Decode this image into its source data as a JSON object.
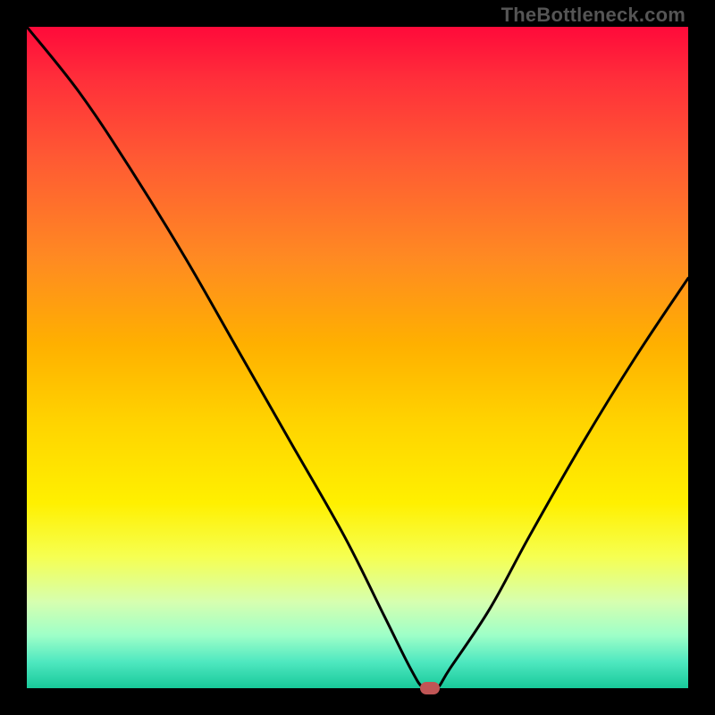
{
  "watermark": "TheBottleneck.com",
  "chart_data": {
    "type": "line",
    "title": "",
    "xlabel": "",
    "ylabel": "",
    "xlim": [
      0,
      100
    ],
    "ylim": [
      0,
      100
    ],
    "grid": false,
    "series": [
      {
        "name": "bottleneck-curve",
        "x": [
          0,
          8,
          16,
          24,
          32,
          40,
          48,
          54,
          58,
          60,
          62,
          64,
          70,
          76,
          84,
          92,
          100
        ],
        "values": [
          100,
          90,
          78,
          65,
          51,
          37,
          23,
          11,
          3,
          0,
          0,
          3,
          12,
          23,
          37,
          50,
          62
        ]
      }
    ],
    "marker": {
      "x": 61,
      "y": 0
    },
    "background_gradient": {
      "stops": [
        {
          "pct": 0,
          "color": "#ff0a3a"
        },
        {
          "pct": 50,
          "color": "#ffd400"
        },
        {
          "pct": 85,
          "color": "#f6ff50"
        },
        {
          "pct": 100,
          "color": "#18c99a"
        }
      ]
    }
  }
}
